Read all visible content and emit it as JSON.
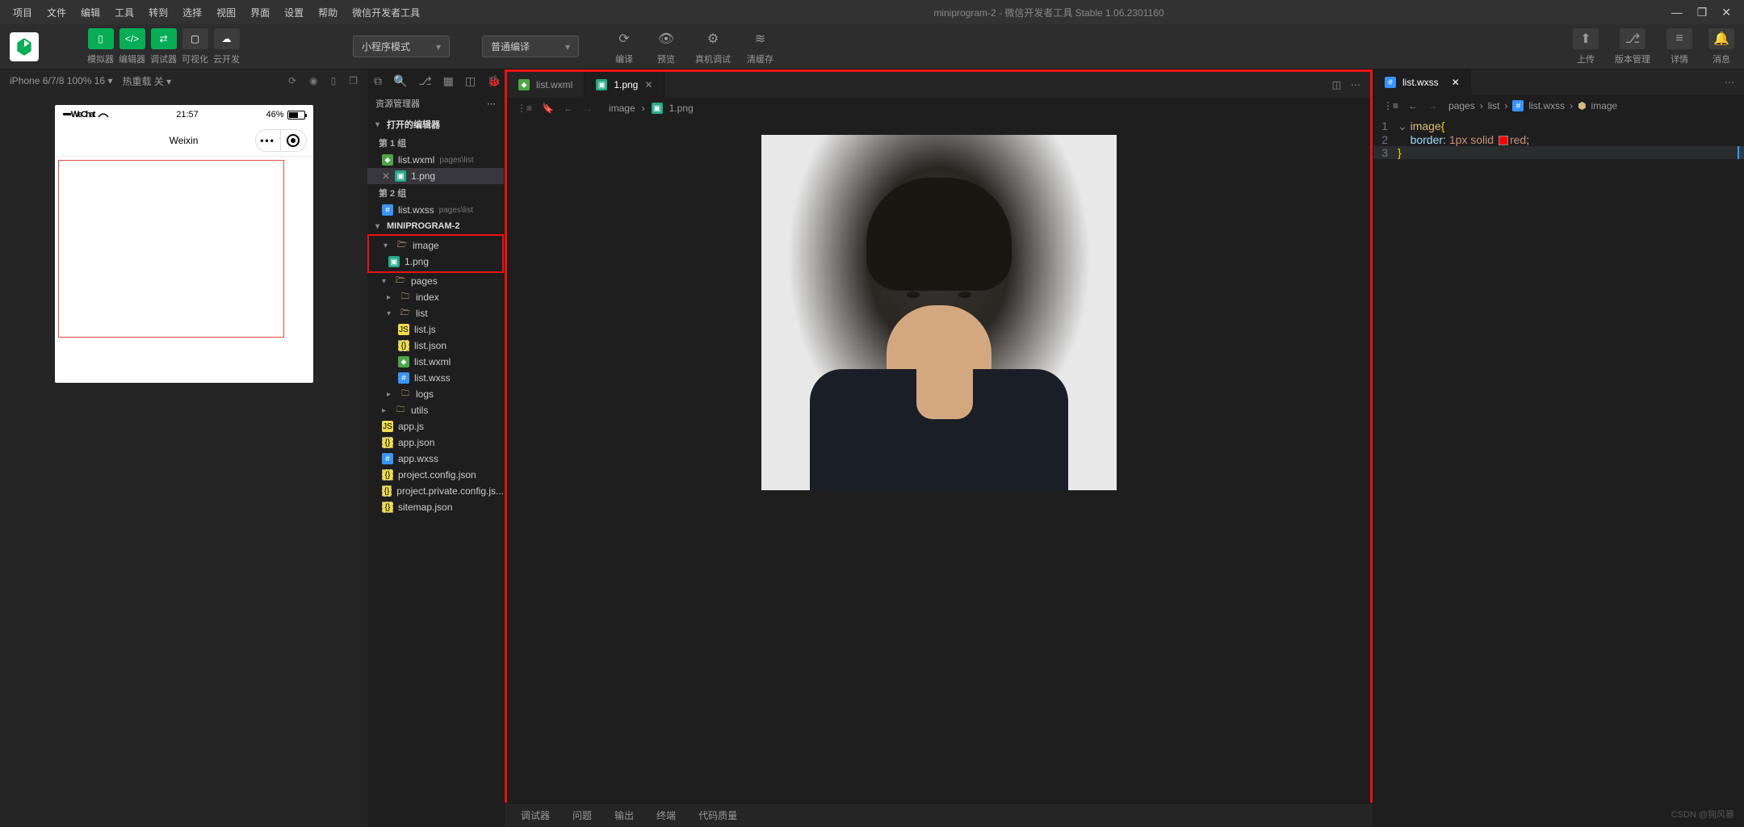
{
  "titlebar": {
    "menus": [
      "项目",
      "文件",
      "编辑",
      "工具",
      "转到",
      "选择",
      "视图",
      "界面",
      "设置",
      "帮助",
      "微信开发者工具"
    ],
    "title_prefix": "miniprogram-2",
    "title_suffix": " - 微信开发者工具 Stable 1.06.2301160"
  },
  "toolbar": {
    "left": [
      "模拟器",
      "编辑器",
      "调试器",
      "可视化",
      "云开发"
    ],
    "mode_select": "小程序模式",
    "compile_select": "普通编译",
    "center": [
      "编译",
      "预览",
      "真机调试",
      "清缓存"
    ],
    "right": [
      "上传",
      "版本管理",
      "详情",
      "消息"
    ]
  },
  "simulator": {
    "device": "iPhone 6/7/8 100% 16",
    "reload": "热重载 关",
    "statusbar": {
      "signal": "••••• WeChat",
      "time": "21:57",
      "battery": "46%"
    },
    "nav_title": "Weixin"
  },
  "explorer": {
    "title": "资源管理器",
    "open_editors": "打开的编辑器",
    "group1": "第 1 组",
    "group2": "第 2 组",
    "project": "MINIPROGRAM-2",
    "files": {
      "list_wxml": "list.wxml",
      "list_wxml_path": "pages\\list",
      "png1": "1.png",
      "list_wxss": "list.wxss",
      "list_wxss_path": "pages\\list",
      "image": "image",
      "pages": "pages",
      "index": "index",
      "list": "list",
      "list_js": "list.js",
      "list_json": "list.json",
      "logs": "logs",
      "utils": "utils",
      "app_js": "app.js",
      "app_json": "app.json",
      "app_wxss": "app.wxss",
      "proj_config": "project.config.json",
      "proj_private": "project.private.config.js...",
      "sitemap": "sitemap.json"
    }
  },
  "editor": {
    "tabs": [
      {
        "name": "list.wxml",
        "icon": "wxml"
      },
      {
        "name": "1.png",
        "icon": "png",
        "active": true
      }
    ],
    "breadcrumb": [
      "image",
      "1.png"
    ]
  },
  "code": {
    "tab": "list.wxss",
    "breadcrumb": [
      "pages",
      "list",
      "list.wxss",
      "image"
    ],
    "selector": "image",
    "prop": "border",
    "value_pre": "1px solid ",
    "value_color": "red"
  },
  "bottom": [
    "调试器",
    "问题",
    "输出",
    "终端",
    "代码质量"
  ],
  "watermark": "CSDN @狗风暴"
}
